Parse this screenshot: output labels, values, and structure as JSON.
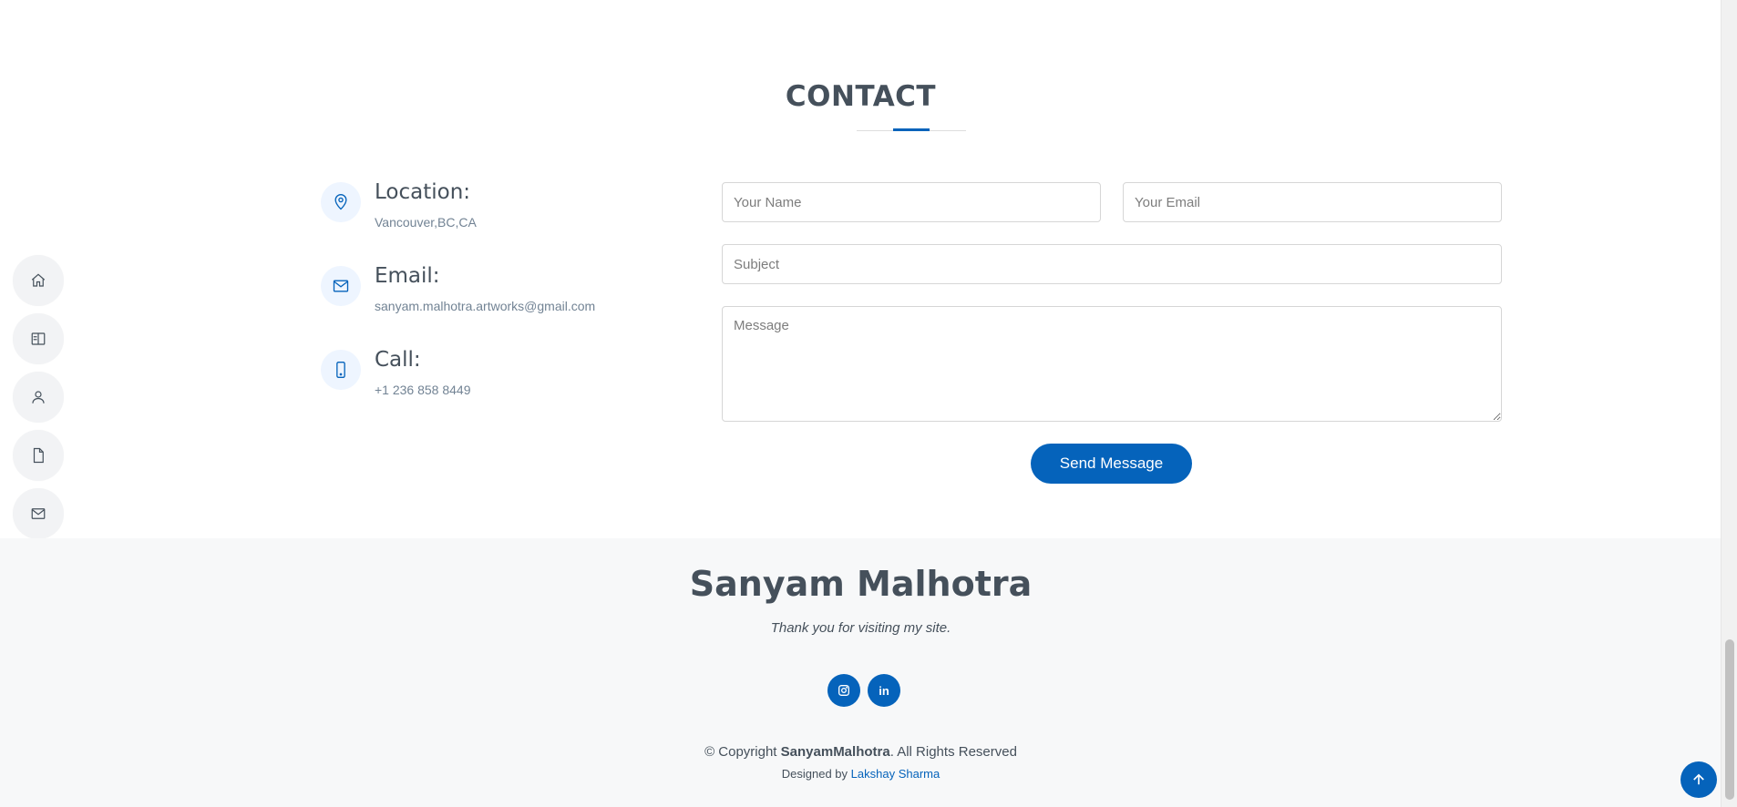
{
  "nav": {
    "items": [
      {
        "icon": "home-icon"
      },
      {
        "icon": "resume-icon"
      },
      {
        "icon": "person-icon"
      },
      {
        "icon": "file-icon"
      },
      {
        "icon": "envelope-icon"
      }
    ]
  },
  "contact": {
    "title": "CONTACT",
    "info": [
      {
        "label": "Location:",
        "value": "Vancouver,BC,CA",
        "icon": "location-pin-icon"
      },
      {
        "label": "Email:",
        "value": "sanyam.malhotra.artworks@gmail.com",
        "icon": "envelope-icon"
      },
      {
        "label": "Call:",
        "value": "+1 236 858 8449",
        "icon": "phone-icon"
      }
    ],
    "form": {
      "name_placeholder": "Your Name",
      "email_placeholder": "Your Email",
      "subject_placeholder": "Subject",
      "message_placeholder": "Message",
      "submit_label": "Send Message"
    }
  },
  "footer": {
    "name": "Sanyam Malhotra",
    "tagline": "Thank you for visiting my site.",
    "social": [
      {
        "icon": "instagram-icon"
      },
      {
        "icon": "linkedin-icon",
        "text": "in"
      }
    ],
    "copyright_prefix": "© Copyright ",
    "copyright_name": "SanyamMalhotra",
    "copyright_suffix": ". All Rights Reserved",
    "designed_by_prefix": "Designed by ",
    "designer": "Lakshay Sharma"
  },
  "colors": {
    "accent": "#0563bb",
    "heading": "#45505b",
    "footer_bg": "#f7f8f9"
  }
}
